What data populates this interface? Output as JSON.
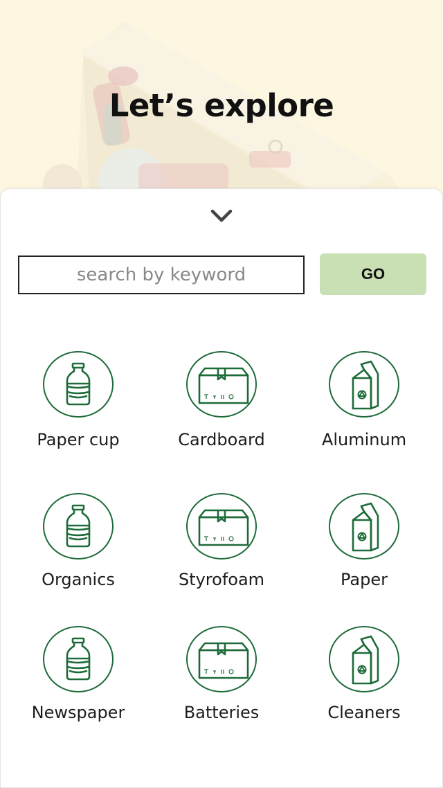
{
  "hero": {
    "title": "Let’s explore"
  },
  "search": {
    "placeholder": "search by keyword",
    "value": ""
  },
  "go_button": {
    "label": "GO"
  },
  "colors": {
    "brand_green": "#1e6b3a",
    "go_button_bg": "#c9dfb4",
    "hero_bg": "#fdf6e0"
  },
  "categories": [
    {
      "label": "Paper cup",
      "icon": "bottle-icon"
    },
    {
      "label": "Cardboard",
      "icon": "box-icon"
    },
    {
      "label": "Aluminum",
      "icon": "carton-icon"
    },
    {
      "label": "Organics",
      "icon": "bottle-icon"
    },
    {
      "label": "Styrofoam",
      "icon": "box-icon"
    },
    {
      "label": "Paper",
      "icon": "carton-icon"
    },
    {
      "label": "Newspaper",
      "icon": "bottle-icon"
    },
    {
      "label": "Batteries",
      "icon": "box-icon"
    },
    {
      "label": "Cleaners",
      "icon": "carton-icon"
    }
  ]
}
